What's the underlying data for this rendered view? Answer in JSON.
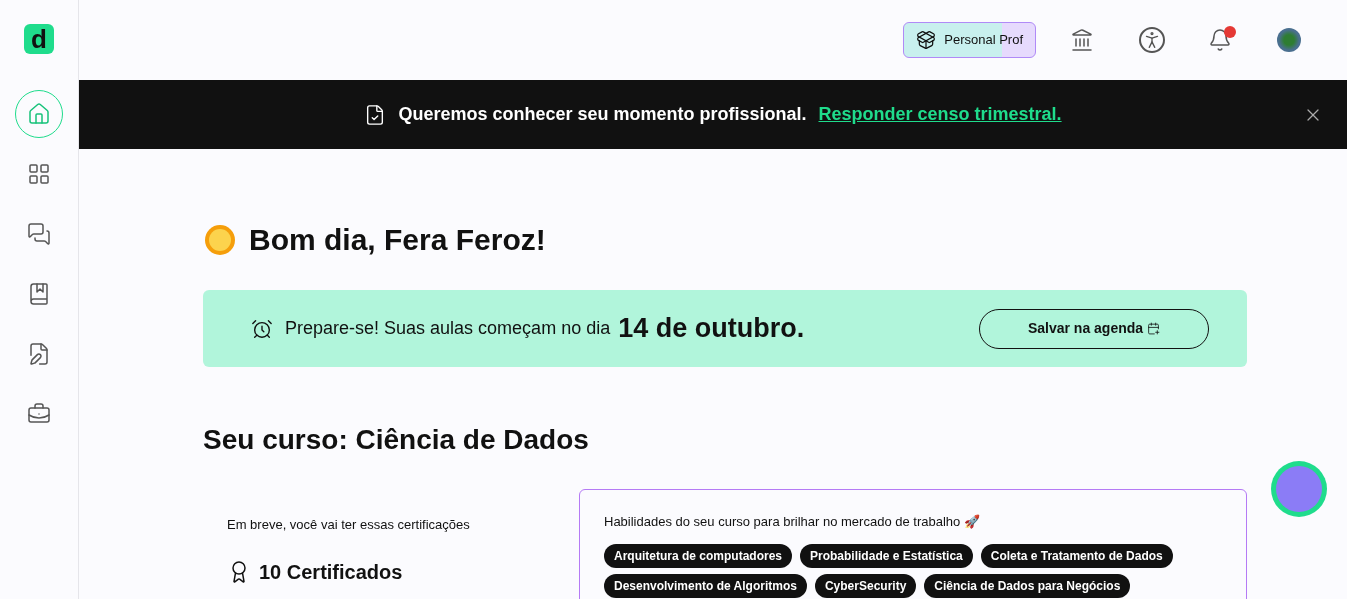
{
  "sidebar": {
    "logo": "d",
    "items": [
      {
        "kind": "home",
        "selected": true
      },
      {
        "kind": "grid",
        "selected": false
      },
      {
        "kind": "chat",
        "selected": false
      },
      {
        "kind": "book",
        "selected": false
      },
      {
        "kind": "notes",
        "selected": false
      },
      {
        "kind": "briefcase",
        "selected": false
      }
    ]
  },
  "header": {
    "badge": "Personal Prof",
    "notification_dot": true
  },
  "banner": {
    "text": "Queremos conhecer seu momento profissional.",
    "link": "Responder censo trimestral."
  },
  "greeting": "Bom dia, Fera Feroz!",
  "notice": {
    "text": "Prepare-se! Suas aulas começam no dia",
    "date": "14 de outubro.",
    "button": "Salvar na agenda"
  },
  "course_title": "Seu curso: Ciência de Dados",
  "certifications": {
    "intro": "Em breve, você vai ter essas certificações",
    "count": "10 Certificados"
  },
  "skills": {
    "title": "Habilidades do seu curso para brilhar no mercado de trabalho 🚀",
    "tags": [
      "Arquitetura de computadores",
      "Probabilidade e Estatística",
      "Coleta e Tratamento de Dados",
      "Desenvolvimento de Algoritmos",
      "CyberSecurity",
      "Ciência de Dados para Negócios"
    ]
  }
}
